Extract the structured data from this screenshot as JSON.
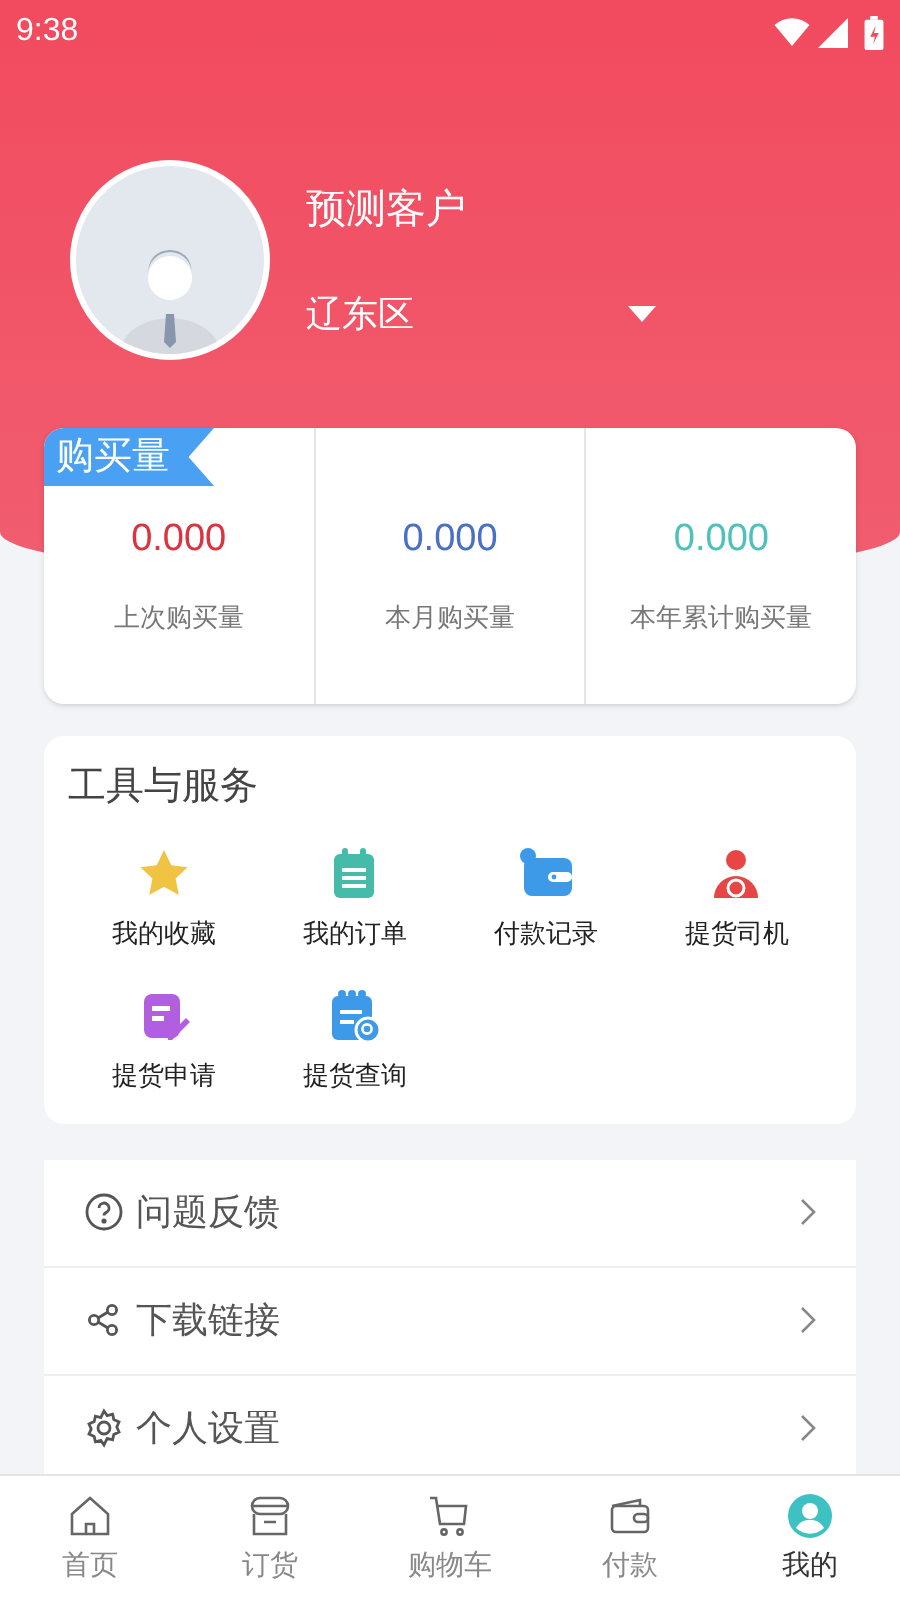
{
  "status_bar": {
    "time": "9:38"
  },
  "profile": {
    "name": "预测客户",
    "region": "辽东区"
  },
  "purchases": {
    "title": "购买量",
    "stats": [
      {
        "value": "0.000",
        "label": "上次购买量",
        "color": "#d9343f"
      },
      {
        "value": "0.000",
        "label": "本月购买量",
        "color": "#4a6fc7"
      },
      {
        "value": "0.000",
        "label": "本年累计购买量",
        "color": "#4ec2b8"
      }
    ]
  },
  "tools": {
    "title": "工具与服务",
    "items": [
      {
        "label": "我的收藏",
        "kind": "star"
      },
      {
        "label": "我的订单",
        "kind": "clipboard"
      },
      {
        "label": "付款记录",
        "kind": "wallet"
      },
      {
        "label": "提货司机",
        "kind": "driver"
      },
      {
        "label": "提货申请",
        "kind": "edit"
      },
      {
        "label": "提货查询",
        "kind": "search-doc"
      }
    ]
  },
  "menu": [
    {
      "label": "问题反馈",
      "kind": "help"
    },
    {
      "label": "下载链接",
      "kind": "share"
    },
    {
      "label": "个人设置",
      "kind": "settings"
    }
  ],
  "tab_bar": [
    {
      "label": "首页",
      "kind": "home",
      "selected": false
    },
    {
      "label": "订货",
      "kind": "store",
      "selected": false
    },
    {
      "label": "购物车",
      "kind": "cart",
      "selected": false
    },
    {
      "label": "付款",
      "kind": "wallet",
      "selected": false
    },
    {
      "label": "我的",
      "kind": "user",
      "selected": true
    }
  ]
}
